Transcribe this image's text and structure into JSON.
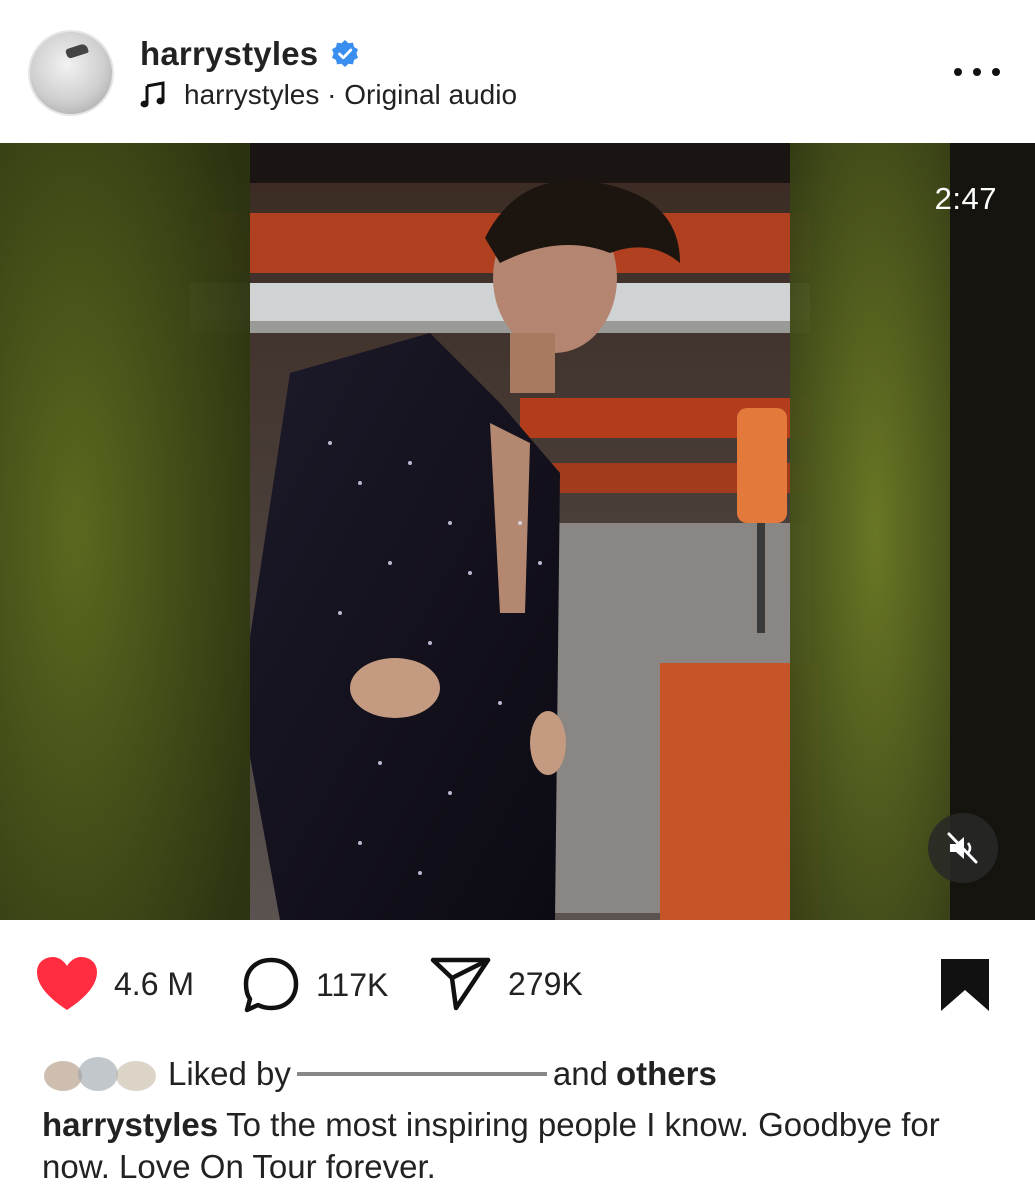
{
  "header": {
    "username": "harrystyles",
    "verified_icon": "verified-badge-icon",
    "audio_icon": "music-note-icon",
    "audio_text": "harrystyles · Original audio",
    "more_icon": "more-dots-icon"
  },
  "media": {
    "duration": "2:47",
    "mute_icon": "speaker-muted-icon"
  },
  "actions": {
    "like_count": "4.6 M",
    "comment_count": "117K",
    "share_count": "279K",
    "like_color": "#ff2d3f"
  },
  "liked_by": {
    "prefix": "Liked by",
    "suffix": "and",
    "others": "others"
  },
  "caption": {
    "username": "harrystyles",
    "text": "To the most inspiring people I know. Goodbye for now. Love On Tour forever."
  }
}
